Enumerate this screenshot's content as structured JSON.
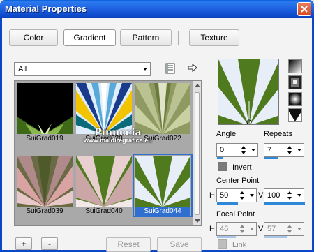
{
  "window": {
    "title": "Material Properties"
  },
  "tabs": [
    {
      "label": "Color",
      "active": false
    },
    {
      "label": "Gradient",
      "active": true
    },
    {
      "label": "Pattern",
      "active": false
    },
    {
      "label": "Texture",
      "active": false
    }
  ],
  "category_select": {
    "value": "All"
  },
  "gradients": [
    {
      "name": "SuiGrad019"
    },
    {
      "name": "SuiGrad020"
    },
    {
      "name": "SuiGrad022"
    },
    {
      "name": "SuiGrad039"
    },
    {
      "name": "SuiGrad040"
    },
    {
      "name": "SuiGrad044",
      "selected": true
    }
  ],
  "watermark": {
    "line1": "Pinuccia",
    "line2": "www.maidiregrafica.eu"
  },
  "buttons": {
    "add": "+",
    "remove": "-",
    "reset": "Reset",
    "save": "Save"
  },
  "angle": {
    "label": "Angle",
    "value": "0"
  },
  "repeats": {
    "label": "Repeats",
    "value": "7"
  },
  "invert": {
    "label": "Invert",
    "checked": false
  },
  "center_point": {
    "label": "Center Point",
    "h_label": "H",
    "h_value": "50",
    "v_label": "V",
    "v_value": "100"
  },
  "focal_point": {
    "label": "Focal Point",
    "h_label": "H",
    "h_value": "46",
    "v_label": "V",
    "v_value": "57"
  },
  "link": {
    "label": "Link",
    "checked": false
  },
  "colors": {
    "accent": "#2f6fd0",
    "green": "#4f7a1e",
    "title_blue": "#0b47c8"
  }
}
